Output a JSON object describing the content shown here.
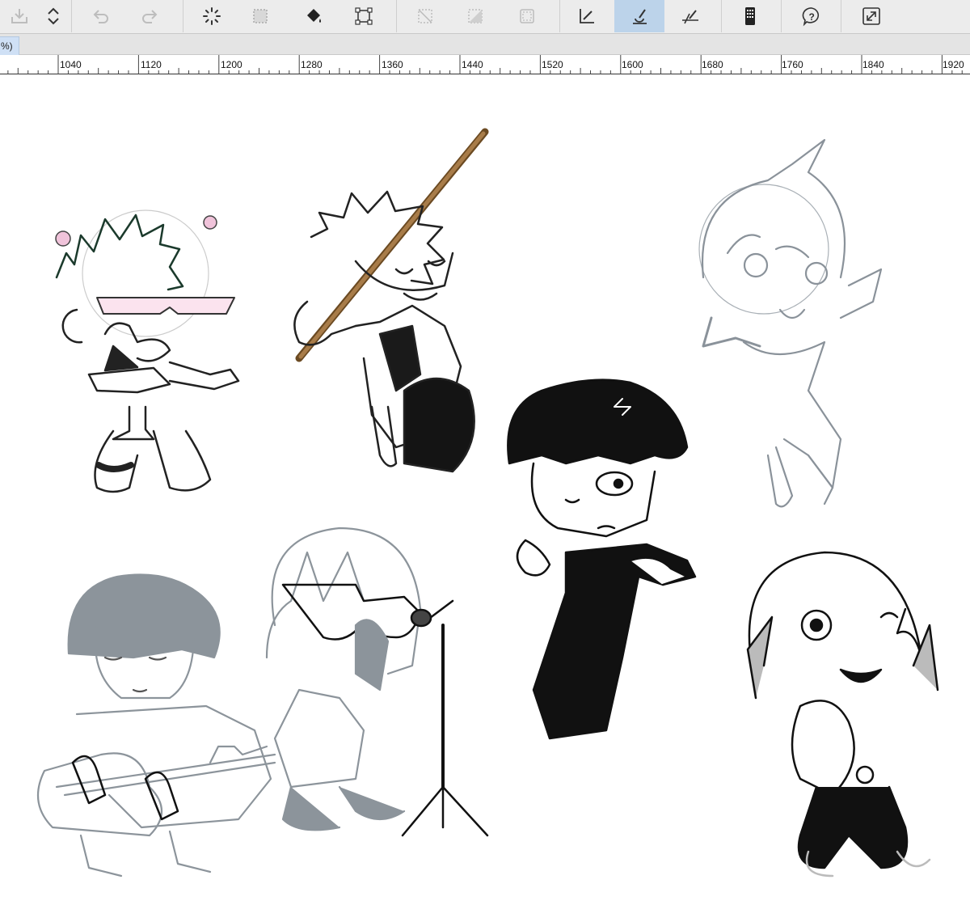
{
  "toolbar": {
    "tools": [
      {
        "name": "save-icon",
        "tooltip": "Save"
      },
      {
        "name": "updown-arrows-icon",
        "tooltip": "Toggle"
      },
      {
        "name": "undo-icon",
        "tooltip": "Undo"
      },
      {
        "name": "redo-icon",
        "tooltip": "Redo"
      },
      {
        "name": "loading-spinner-icon",
        "tooltip": "Processing"
      },
      {
        "name": "selection-marquee-icon",
        "tooltip": "Selection"
      },
      {
        "name": "fill-bucket-icon",
        "tooltip": "Fill"
      },
      {
        "name": "transform-icon",
        "tooltip": "Transform"
      },
      {
        "name": "clear-selection-icon",
        "tooltip": "Clear"
      },
      {
        "name": "invert-selection-icon",
        "tooltip": "Invert"
      },
      {
        "name": "select-all-icon",
        "tooltip": "Select all"
      },
      {
        "name": "ruler-pen-icon",
        "tooltip": "Ruler"
      },
      {
        "name": "brush-snap-icon",
        "tooltip": "Snap",
        "active": true
      },
      {
        "name": "perspective-ruler-icon",
        "tooltip": "Perspective"
      },
      {
        "name": "device-icon",
        "tooltip": "Device"
      },
      {
        "name": "help-icon",
        "tooltip": "Help"
      },
      {
        "name": "fullscreen-icon",
        "tooltip": "Fullscreen"
      }
    ],
    "active_color": "#bcd3ea"
  },
  "tab": {
    "label": "%)"
  },
  "ruler": {
    "labels": [
      "1040",
      "1120",
      "1200",
      "1280",
      "1360",
      "1440",
      "1520",
      "1600",
      "1680",
      "1760",
      "1840",
      "1920"
    ]
  },
  "canvas": {
    "background": "#ffffff",
    "sketches": [
      {
        "name": "sketch-glasses-boy"
      },
      {
        "name": "sketch-sword-boy"
      },
      {
        "name": "sketch-gray-girl"
      },
      {
        "name": "sketch-black-hair-boy"
      },
      {
        "name": "sketch-guitar-boy"
      },
      {
        "name": "sketch-singer-girl"
      },
      {
        "name": "sketch-smiling-girl"
      }
    ]
  }
}
